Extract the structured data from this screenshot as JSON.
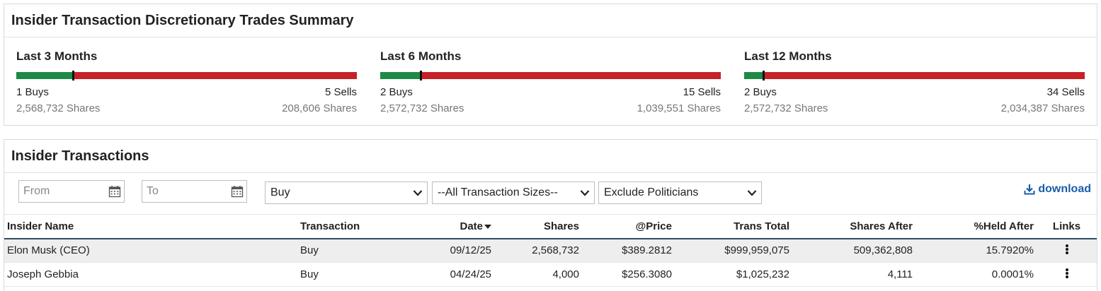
{
  "summary": {
    "title": "Insider Transaction Discretionary Trades Summary",
    "periods": [
      {
        "label": "Last 3 Months",
        "buys": "1 Buys",
        "sells": "5 Sells",
        "buy_shares": "2,568,732 Shares",
        "sell_shares": "208,606 Shares",
        "buy_fraction": 0.167
      },
      {
        "label": "Last 6 Months",
        "buys": "2 Buys",
        "sells": "15 Sells",
        "buy_shares": "2,572,732 Shares",
        "sell_shares": "1,039,551 Shares",
        "buy_fraction": 0.118
      },
      {
        "label": "Last 12 Months",
        "buys": "2 Buys",
        "sells": "34 Sells",
        "buy_shares": "2,572,732 Shares",
        "sell_shares": "2,034,387 Shares",
        "buy_fraction": 0.056
      }
    ],
    "colors": {
      "buy": "#1e8a45",
      "sell": "#c62127"
    }
  },
  "transactions": {
    "title": "Insider Transactions",
    "filters": {
      "from_placeholder": "From",
      "to_placeholder": "To",
      "type_value": "Buy",
      "size_value": "--All Transaction Sizes--",
      "politicians_value": "Exclude Politicians"
    },
    "download_label": "download",
    "columns": {
      "name": "Insider Name",
      "transaction": "Transaction",
      "date": "Date",
      "shares": "Shares",
      "price": "@Price",
      "total": "Trans Total",
      "after": "Shares After",
      "held": "%Held After",
      "links": "Links"
    },
    "rows": [
      {
        "name": "Elon Musk (CEO)",
        "transaction": "Buy",
        "date": "09/12/25",
        "shares": "2,568,732",
        "price": "$389.2812",
        "total": "$999,959,075",
        "after": "509,362,808",
        "held": "15.7920%"
      },
      {
        "name": "Joseph Gebbia",
        "transaction": "Buy",
        "date": "04/24/25",
        "shares": "4,000",
        "price": "$256.3080",
        "total": "$1,025,232",
        "after": "4,111",
        "held": "0.0001%"
      }
    ],
    "accent_color": "#1a5ea8"
  }
}
